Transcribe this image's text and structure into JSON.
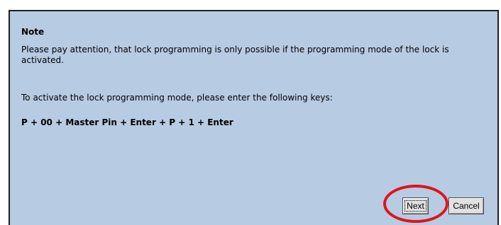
{
  "dialog": {
    "heading": "Note",
    "paragraph_1": "Please pay attention, that lock programming is only possible if the programming mode of the lock is activated.",
    "paragraph_2": "To activate the lock programming mode, please enter the following keys:",
    "key_sequence": "P + 00 + Master Pin + Enter + P + 1 + Enter"
  },
  "buttons": {
    "next_label": "Next",
    "cancel_label": "Cancel"
  },
  "colors": {
    "dialog_background": "#b7cbe3",
    "annotation_circle": "#e0141b"
  }
}
